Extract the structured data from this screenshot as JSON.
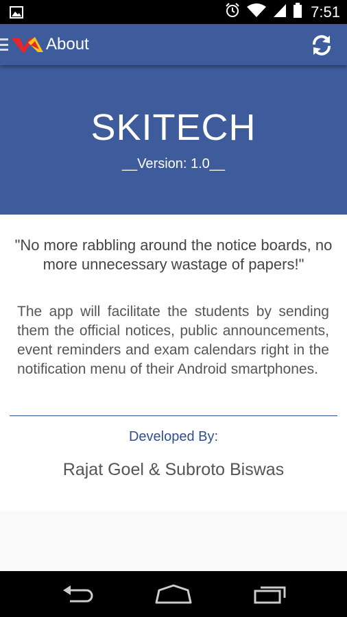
{
  "status_bar": {
    "time": "7:51",
    "icons": [
      "picture-notification-icon",
      "alarm-icon",
      "wifi-icon",
      "signal-icon",
      "battery-icon"
    ]
  },
  "action_bar": {
    "title": "About",
    "icons": [
      "drawer-icon",
      "app-logo-icon",
      "refresh-icon"
    ],
    "background": "#3e5c9c"
  },
  "hero": {
    "app_name": "SKITECH",
    "version": "__Version: 1.0__"
  },
  "content": {
    "quote": "\"No more rabbling around the notice boards, no more unnecessary wastage of papers!\"",
    "description": "The app will facilitate the students by sending them the official notices, public announcements, event reminders and exam calendars right in the notification menu of their Android smartphones.",
    "developed_by_label": "Developed By:",
    "developers": "Rajat Goel  &  Subroto Biswas"
  },
  "nav_bar": {
    "icons": [
      "back-icon",
      "home-icon",
      "recent-apps-icon"
    ]
  }
}
